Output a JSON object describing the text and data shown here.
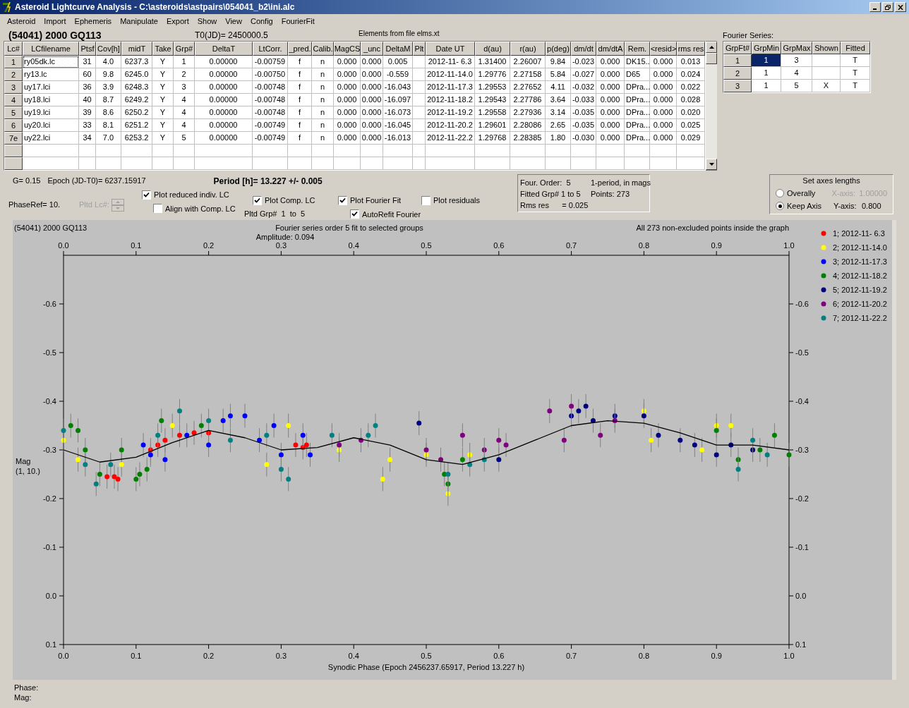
{
  "window": {
    "title": "Asteroid Lightcurve Analysis - C:\\asteroids\\astpairs\\054041_b2\\ini.alc"
  },
  "menu": [
    "Asteroid",
    "Import",
    "Ephemeris",
    "Manipulate",
    "Export",
    "Show",
    "View",
    "Config",
    "FourierFit"
  ],
  "header": {
    "object": "(54041) 2000 GQ113",
    "t0": "T0(JD)= 2450000.5",
    "elements": "Elements from file elms.xt"
  },
  "table": {
    "columns": [
      "Lc#",
      "LCfilename",
      "Ptsf",
      "Cov[h]",
      "midT",
      "Take",
      "Grp#",
      "DeltaT",
      "LtCorr.",
      "_pred.",
      "Calib.",
      "MagCS",
      "_unc",
      "DeltaM",
      "Plt",
      "Date UT",
      "d(au)",
      "r(au)",
      "p(deg)",
      "dm/dt",
      "dm/dtA",
      "Rem.",
      "<resid>",
      "rms res"
    ],
    "rows": [
      {
        "focused": true,
        "cells": [
          "1",
          "ry05dk.lc",
          "31",
          "4.0",
          "6237.3",
          "Y",
          "1",
          "0.00000",
          "-0.00759",
          "f",
          "n",
          "0.000",
          "0.000",
          "0.005",
          null,
          "2012-11- 6.3",
          "1.31400",
          "2.26007",
          "9.84",
          "-0.023",
          "0.000",
          "DK15..",
          "0.000",
          "0.013"
        ]
      },
      {
        "focused": false,
        "cells": [
          "2",
          "ry13.lc",
          "60",
          "9.8",
          "6245.0",
          "Y",
          "2",
          "0.00000",
          "-0.00750",
          "f",
          "n",
          "0.000",
          "0.000",
          "-0.559",
          null,
          "2012-11-14.0",
          "1.29776",
          "2.27158",
          "5.84",
          "-0.027",
          "0.000",
          "D65",
          "0.000",
          "0.024"
        ]
      },
      {
        "focused": false,
        "cells": [
          "3",
          "uy17.lci",
          "36",
          "3.9",
          "6248.3",
          "Y",
          "3",
          "0.00000",
          "-0.00748",
          "f",
          "n",
          "0.000",
          "0.000",
          "-16.043",
          null,
          "2012-11-17.3",
          "1.29553",
          "2.27652",
          "4.11",
          "-0.032",
          "0.000",
          "DPra...",
          "0.000",
          "0.022"
        ]
      },
      {
        "focused": false,
        "cells": [
          "4",
          "uy18.lci",
          "40",
          "8.7",
          "6249.2",
          "Y",
          "4",
          "0.00000",
          "-0.00748",
          "f",
          "n",
          "0.000",
          "0.000",
          "-16.097",
          null,
          "2012-11-18.2",
          "1.29543",
          "2.27786",
          "3.64",
          "-0.033",
          "0.000",
          "DPra...",
          "0.000",
          "0.028"
        ]
      },
      {
        "focused": false,
        "cells": [
          "5",
          "uy19.lci",
          "39",
          "8.6",
          "6250.2",
          "Y",
          "4",
          "0.00000",
          "-0.00748",
          "f",
          "n",
          "0.000",
          "0.000",
          "-16.073",
          null,
          "2012-11-19.2",
          "1.29558",
          "2.27936",
          "3.14",
          "-0.035",
          "0.000",
          "DPra...",
          "0.000",
          "0.020"
        ]
      },
      {
        "focused": false,
        "cells": [
          "6",
          "uy20.lci",
          "33",
          "8.1",
          "6251.2",
          "Y",
          "4",
          "0.00000",
          "-0.00749",
          "f",
          "n",
          "0.000",
          "0.000",
          "-16.045",
          null,
          "2012-11-20.2",
          "1.29601",
          "2.28086",
          "2.65",
          "-0.035",
          "0.000",
          "DPra...",
          "0.000",
          "0.025"
        ]
      },
      {
        "focused": false,
        "cells": [
          "7e",
          "uy22.lci",
          "34",
          "7.0",
          "6253.2",
          "Y",
          "5",
          "0.00000",
          "-0.00749",
          "f",
          "n",
          "0.000",
          "0.000",
          "-16.013",
          null,
          "2012-11-22.2",
          "1.29768",
          "2.28385",
          "1.80",
          "-0.030",
          "0.000",
          "DPra...",
          "0.000",
          "0.029"
        ]
      }
    ]
  },
  "fourier": {
    "title": "Fourier Series:",
    "columns": [
      "GrpFt#",
      "GrpMin",
      "GrpMax",
      "Shown",
      "Fitted"
    ],
    "rows": [
      {
        "id": "1",
        "min": "1",
        "max": "3",
        "fitted": "T",
        "min_selected": true
      },
      {
        "id": "2",
        "min": "1",
        "max": "4",
        "fitted": "T",
        "min_selected": false
      },
      {
        "id": "3",
        "min": "1",
        "max": "5",
        "shown": "X",
        "fitted": "T",
        "min_selected": false
      }
    ]
  },
  "info": {
    "g": "G= 0.15",
    "epoch": "Epoch (JD-T0)= 6237.15917",
    "period": "Period [h]= 13.227 +/- 0.005",
    "phase_ref": "PhaseRef= 10.",
    "pltd_lc": {
      "label": "Pltd Lc#:",
      "disabled": true
    },
    "pltd_grp": "Pltd Grp#  1  to  5"
  },
  "plot_options": [
    {
      "label": "Plot reduced indiv. LC",
      "checked": true
    },
    {
      "label": "Align with Comp. LC",
      "checked": false
    },
    {
      "label": "Plot Comp. LC",
      "checked": true
    },
    {
      "label": "Plot Fourier Fit",
      "checked": true
    },
    {
      "label": "AutoRefit Fourier",
      "checked": true
    },
    {
      "label": "Plot residuals",
      "checked": false
    }
  ],
  "fit_summary": [
    "Four. Order:  5",
    "1-period, in mags",
    "Fitted Grp# 1 to 5",
    "Points: 273",
    "Rms res      = 0.025"
  ],
  "axes": {
    "title": "Set axes lengths",
    "options": [
      {
        "label": "Overally",
        "selected": false
      },
      {
        "label": "Keep Axis",
        "selected": true
      }
    ],
    "fields": [
      {
        "label": "X-axis:",
        "value": "1.00000",
        "disabled": true
      },
      {
        "label": "Y-axis:",
        "value": "0.800",
        "disabled": false
      }
    ]
  },
  "chart": {
    "object": "(54041) 2000 GQ113",
    "status": "All 273 non-excluded points inside the graph",
    "ylabel_sub": "(1, 10.)",
    "chart_data": {
      "type": "scatter",
      "title": "Fourier series order 5 fit to selected groups",
      "annotations": [
        "Amplitude: 0.094"
      ],
      "xlabel": "Synodic Phase (Epoch 2456237.65917, Period 13.227 h)",
      "ylabel": "Mag",
      "legend": true,
      "xlim": [
        0,
        1
      ],
      "ylim": [
        0.1,
        -0.7
      ],
      "xticks": [
        {
          "value": 0,
          "label": "0.0"
        },
        {
          "value": 0.1,
          "label": "0.1"
        },
        {
          "value": 0.2,
          "label": "0.2"
        },
        {
          "value": 0.3,
          "label": "0.3"
        },
        {
          "value": 0.4,
          "label": "0.4"
        },
        {
          "value": 0.5,
          "label": "0.5"
        },
        {
          "value": 0.6,
          "label": "0.6"
        },
        {
          "value": 0.7,
          "label": "0.7"
        },
        {
          "value": 0.8,
          "label": "0.8"
        },
        {
          "value": 0.9,
          "label": "0.9"
        },
        {
          "value": 1,
          "label": "1.0"
        }
      ],
      "yticks": [
        {
          "value": -0.6,
          "label": "-0.6"
        },
        {
          "value": -0.5,
          "label": "-0.5"
        },
        {
          "value": -0.4,
          "label": "-0.4"
        },
        {
          "value": -0.3,
          "label": "-0.3"
        },
        {
          "value": -0.2,
          "label": "-0.2"
        },
        {
          "value": -0.1,
          "label": "-0.1"
        },
        {
          "value": 0,
          "label": "0.0"
        },
        {
          "value": 0.1,
          "label": "0.1"
        }
      ],
      "series": [
        {
          "name": "1; 2012-11- 6.3",
          "color": "#ff0000",
          "x": [
            0.06,
            0.07,
            0.075,
            0.12,
            0.13,
            0.14,
            0.16,
            0.18,
            0.2,
            0.32,
            0.33,
            0.335
          ],
          "values": [
            -0.245,
            -0.245,
            -0.24,
            -0.3,
            -0.31,
            -0.32,
            -0.33,
            -0.335,
            -0.335,
            -0.31,
            -0.305,
            -0.31
          ]
        },
        {
          "name": "2; 2012-11-14.0",
          "color": "#ffff00",
          "x": [
            0.0,
            0.02,
            0.08,
            0.15,
            0.28,
            0.31,
            0.38,
            0.44,
            0.45,
            0.5,
            0.53,
            0.56,
            0.8,
            0.81,
            0.88,
            0.9,
            0.92
          ],
          "values": [
            -0.32,
            -0.28,
            -0.27,
            -0.35,
            -0.27,
            -0.35,
            -0.3,
            -0.24,
            -0.28,
            -0.29,
            -0.21,
            -0.29,
            -0.38,
            -0.32,
            -0.3,
            -0.35,
            -0.35
          ]
        },
        {
          "name": "3; 2012-11-17.3",
          "color": "#0000ff",
          "x": [
            0.11,
            0.12,
            0.14,
            0.17,
            0.2,
            0.22,
            0.23,
            0.25,
            0.27,
            0.29,
            0.3,
            0.33,
            0.34
          ],
          "values": [
            -0.31,
            -0.29,
            -0.28,
            -0.33,
            -0.31,
            -0.36,
            -0.37,
            -0.37,
            -0.32,
            -0.35,
            -0.29,
            -0.33,
            -0.29
          ]
        },
        {
          "name": "4; 2012-11-18.2",
          "color": "#008000",
          "x": [
            0.01,
            0.02,
            0.03,
            0.05,
            0.08,
            0.1,
            0.105,
            0.115,
            0.135,
            0.19,
            0.525,
            0.53,
            0.55,
            0.9,
            0.93,
            0.96,
            0.98,
            1.0
          ],
          "values": [
            -0.35,
            -0.34,
            -0.3,
            -0.25,
            -0.3,
            -0.24,
            -0.25,
            -0.26,
            -0.36,
            -0.35,
            -0.25,
            -0.23,
            -0.28,
            -0.34,
            -0.28,
            -0.3,
            -0.33,
            -0.29
          ]
        },
        {
          "name": "5; 2012-11-19.2",
          "color": "#000080",
          "x": [
            0.49,
            0.6,
            0.7,
            0.71,
            0.72,
            0.73,
            0.76,
            0.8,
            0.82,
            0.85,
            0.87,
            0.9,
            0.92,
            0.95
          ],
          "values": [
            -0.355,
            -0.28,
            -0.37,
            -0.38,
            -0.39,
            -0.36,
            -0.37,
            -0.37,
            -0.33,
            -0.32,
            -0.31,
            -0.29,
            -0.31,
            -0.3
          ]
        },
        {
          "name": "6; 2012-11-20.2",
          "color": "#800080",
          "x": [
            0.38,
            0.41,
            0.5,
            0.52,
            0.55,
            0.58,
            0.6,
            0.61,
            0.67,
            0.69,
            0.7,
            0.74,
            0.76
          ],
          "values": [
            -0.31,
            -0.32,
            -0.3,
            -0.28,
            -0.33,
            -0.3,
            -0.32,
            -0.31,
            -0.38,
            -0.32,
            -0.39,
            -0.33,
            -0.36
          ]
        },
        {
          "name": "7; 2012-11-22.2",
          "color": "#008080",
          "x": [
            0.0,
            0.03,
            0.045,
            0.065,
            0.13,
            0.16,
            0.2,
            0.23,
            0.28,
            0.3,
            0.31,
            0.37,
            0.42,
            0.43,
            0.53,
            0.56,
            0.58,
            0.93,
            0.95,
            0.97
          ],
          "values": [
            -0.34,
            -0.27,
            -0.23,
            -0.27,
            -0.33,
            -0.38,
            -0.36,
            -0.32,
            -0.33,
            -0.26,
            -0.24,
            -0.33,
            -0.33,
            -0.35,
            -0.25,
            -0.27,
            -0.28,
            -0.26,
            -0.32,
            -0.29
          ]
        },
        {
          "type": "line",
          "color": "#000000",
          "x": [
            0,
            0.05,
            0.1,
            0.15,
            0.2,
            0.25,
            0.3,
            0.35,
            0.4,
            0.45,
            0.5,
            0.55,
            0.6,
            0.65,
            0.7,
            0.75,
            0.8,
            0.85,
            0.9,
            0.95,
            1.0
          ],
          "values": [
            -0.3,
            -0.275,
            -0.285,
            -0.315,
            -0.34,
            -0.325,
            -0.3,
            -0.305,
            -0.325,
            -0.31,
            -0.28,
            -0.27,
            -0.29,
            -0.32,
            -0.35,
            -0.36,
            -0.355,
            -0.335,
            -0.31,
            -0.31,
            -0.3
          ]
        }
      ]
    }
  },
  "status": [
    "Phase:",
    "Mag:"
  ]
}
